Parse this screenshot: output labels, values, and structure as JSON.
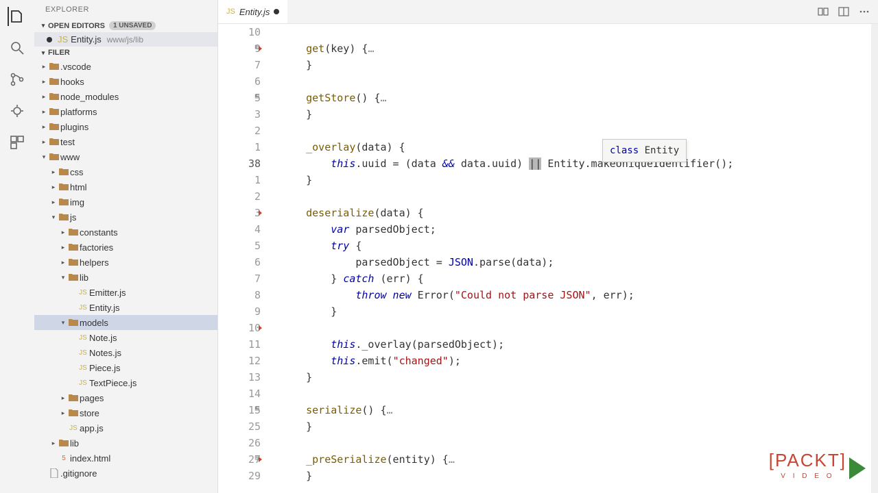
{
  "explorer_title": "EXPLORER",
  "open_editors_title": "OPEN EDITORS",
  "unsaved_badge": "1 UNSAVED",
  "open_editor": {
    "name": "Entity.js",
    "path": "www/js/lib"
  },
  "project_title": "FILER",
  "tree": [
    {
      "depth": 0,
      "label": ".vscode",
      "type": "folder",
      "open": false
    },
    {
      "depth": 0,
      "label": "hooks",
      "type": "folder",
      "open": false
    },
    {
      "depth": 0,
      "label": "node_modules",
      "type": "folder",
      "open": false
    },
    {
      "depth": 0,
      "label": "platforms",
      "type": "folder",
      "open": false
    },
    {
      "depth": 0,
      "label": "plugins",
      "type": "folder",
      "open": false
    },
    {
      "depth": 0,
      "label": "test",
      "type": "folder",
      "open": false
    },
    {
      "depth": 0,
      "label": "www",
      "type": "folder",
      "open": true
    },
    {
      "depth": 1,
      "label": "css",
      "type": "folder",
      "open": false,
      "iconColor": "css"
    },
    {
      "depth": 1,
      "label": "html",
      "type": "folder",
      "open": false
    },
    {
      "depth": 1,
      "label": "img",
      "type": "folder",
      "open": false
    },
    {
      "depth": 1,
      "label": "js",
      "type": "folder",
      "open": true
    },
    {
      "depth": 2,
      "label": "constants",
      "type": "folder",
      "open": false
    },
    {
      "depth": 2,
      "label": "factories",
      "type": "folder",
      "open": false
    },
    {
      "depth": 2,
      "label": "helpers",
      "type": "folder",
      "open": false
    },
    {
      "depth": 2,
      "label": "lib",
      "type": "folder",
      "open": true
    },
    {
      "depth": 3,
      "label": "Emitter.js",
      "type": "js"
    },
    {
      "depth": 3,
      "label": "Entity.js",
      "type": "js"
    },
    {
      "depth": 2,
      "label": "models",
      "type": "folder",
      "open": true,
      "selected": true
    },
    {
      "depth": 3,
      "label": "Note.js",
      "type": "js"
    },
    {
      "depth": 3,
      "label": "Notes.js",
      "type": "js"
    },
    {
      "depth": 3,
      "label": "Piece.js",
      "type": "js"
    },
    {
      "depth": 3,
      "label": "TextPiece.js",
      "type": "js"
    },
    {
      "depth": 2,
      "label": "pages",
      "type": "folder",
      "open": false
    },
    {
      "depth": 2,
      "label": "store",
      "type": "folder",
      "open": false
    },
    {
      "depth": 2,
      "label": "app.js",
      "type": "js"
    },
    {
      "depth": 1,
      "label": "lib",
      "type": "folder",
      "open": false
    },
    {
      "depth": 1,
      "label": "index.html",
      "type": "html"
    },
    {
      "depth": 0,
      "label": ".gitignore",
      "type": "file"
    }
  ],
  "tab": {
    "name": "Entity.js"
  },
  "hover": {
    "text_kw": "class",
    "text_name": " Entity"
  },
  "gutter": [
    "10",
    "9",
    "7",
    "6",
    "5",
    "3",
    "2",
    "1",
    "38",
    "1",
    "2",
    "3",
    "4",
    "5",
    "6",
    "7",
    "8",
    "9",
    "10",
    "11",
    "12",
    "13",
    "14",
    "15",
    "25",
    "26",
    "27",
    "29"
  ],
  "gutter_meta": {
    "1": {
      "fold": true,
      "mark": true
    },
    "4": {
      "fold": true
    },
    "11": {
      "mark": true
    },
    "18": {
      "mark": true
    },
    "23": {
      "fold": true
    },
    "26": {
      "fold": true,
      "mark": true
    }
  },
  "current_line_idx": 8,
  "code_lines": [
    {
      "html": ""
    },
    {
      "html": "    <span class='fn'>get</span>(key) {<span style='color:#888'>…</span>"
    },
    {
      "html": "    }"
    },
    {
      "html": ""
    },
    {
      "html": "    <span class='fn'>getStore</span>() {<span style='color:#888'>…</span>"
    },
    {
      "html": "    }"
    },
    {
      "html": ""
    },
    {
      "html": "    <span class='fn'>_overlay</span>(data) {"
    },
    {
      "html": "        <span class='it'>this</span>.uuid = (data <span class='it'>&amp;&amp;</span> data.uuid) <span class='cursor-sel'>||</span> Entity.makeUniqueIdentifier();"
    },
    {
      "html": "    }"
    },
    {
      "html": ""
    },
    {
      "html": "    <span class='fn'>deserialize</span>(data) {"
    },
    {
      "html": "        <span class='it'>var</span> parsedObject;"
    },
    {
      "html": "        <span class='it'>try</span> {"
    },
    {
      "html": "            parsedObject = <span class='kw'>JSON</span>.parse(data);"
    },
    {
      "html": "        } <span class='it'>catch</span> (err) {"
    },
    {
      "html": "            <span class='it'>throw new</span> Error(<span class='str'>\"Could not parse JSON\"</span>, err);"
    },
    {
      "html": "        }"
    },
    {
      "html": ""
    },
    {
      "html": "        <span class='it'>this</span>._overlay(parsedObject);"
    },
    {
      "html": "        <span class='it'>this</span>.emit(<span class='str'>\"changed\"</span>);"
    },
    {
      "html": "    }"
    },
    {
      "html": ""
    },
    {
      "html": "    <span class='fn'>serialize</span>() {<span style='color:#888'>…</span>"
    },
    {
      "html": "    }"
    },
    {
      "html": ""
    },
    {
      "html": "    <span class='fn'>_preSerialize</span>(entity) {<span style='color:#888'>…</span>"
    },
    {
      "html": "    }"
    }
  ],
  "watermark": {
    "line1": "[PACKT]",
    "line2": "V I D E O"
  }
}
